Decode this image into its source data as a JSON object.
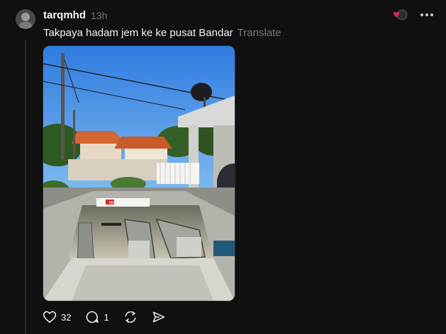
{
  "post": {
    "username": "tarqmhd",
    "time": "13h",
    "text": "Takpaya hadam jem ke ke pusat Bandar",
    "translate_label": "Translate"
  },
  "photo": {
    "sign_text": "MRT",
    "icon": "escalator-photo"
  },
  "actions": {
    "like_count": "32",
    "reply_count": "1"
  },
  "icons": {
    "like": "heart-icon",
    "reply": "comment-icon",
    "repost": "repost-icon",
    "share": "share-icon",
    "more": "more-icon"
  },
  "colors": {
    "background": "#101010",
    "text": "#f3f5f7",
    "muted": "#777777",
    "accent_red": "#e0245e"
  }
}
